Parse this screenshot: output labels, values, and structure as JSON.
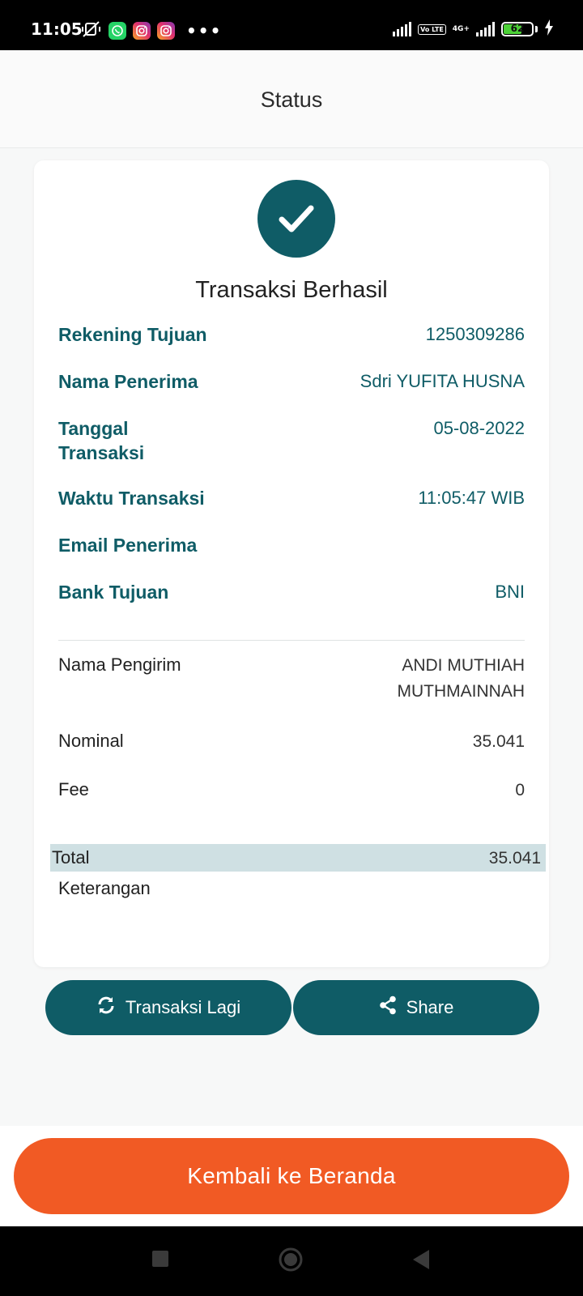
{
  "status_bar": {
    "time": "11:05",
    "battery": "62",
    "network": "4G+",
    "volte": "Vo LTE",
    "more": "•••"
  },
  "header": {
    "title": "Status"
  },
  "receipt": {
    "title": "Transaksi Berhasil",
    "rekening_tujuan": {
      "label": "Rekening Tujuan",
      "value": "1250309286"
    },
    "nama_penerima": {
      "label": "Nama Penerima",
      "value": "Sdri YUFITA HUSNA"
    },
    "tanggal_transaksi": {
      "label_line1": "Tanggal",
      "label_line2": "Transaksi",
      "value": "05-08-2022"
    },
    "waktu_transaksi": {
      "label": "Waktu Transaksi",
      "value": "11:05:47 WIB"
    },
    "email_penerima": {
      "label": "Email Penerima",
      "value": ""
    },
    "bank_tujuan": {
      "label": "Bank Tujuan",
      "value": "BNI"
    },
    "nama_pengirim": {
      "label": "Nama Pengirim",
      "value_line1": "ANDI MUTHIAH",
      "value_line2": "MUTHMAINNAH"
    },
    "nominal": {
      "label": "Nominal",
      "value": "35.041"
    },
    "fee": {
      "label": "Fee",
      "value": "0"
    },
    "total": {
      "label": "Total",
      "value": "35.041"
    },
    "keterangan": {
      "label": "Keterangan",
      "value": ""
    }
  },
  "actions": {
    "again_label": "Transaksi Lagi",
    "share_label": "Share",
    "home_label": "Kembali ke Beranda"
  },
  "colors": {
    "primary": "#0f5c66",
    "accent": "#f15a24",
    "total_highlight": "#cfe0e3"
  }
}
